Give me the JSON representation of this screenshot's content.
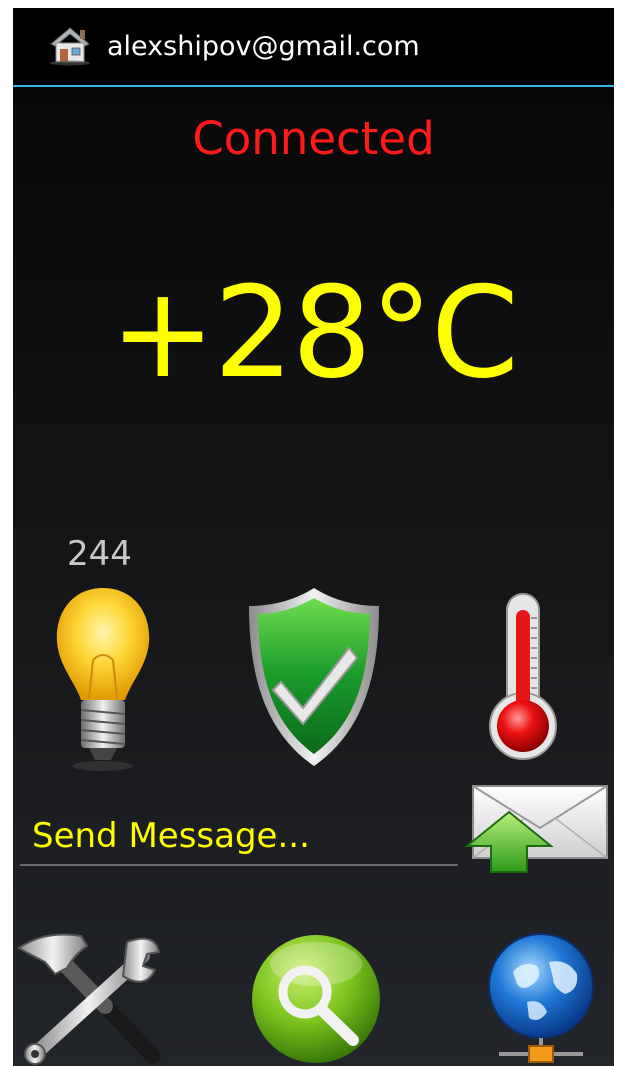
{
  "header": {
    "account": "alexshipov@gmail.com",
    "icon": "home-icon"
  },
  "status": {
    "text": "Connected",
    "color": "#ff1a1a"
  },
  "temperature": {
    "text": "+28°C",
    "color": "#ffff00"
  },
  "sensors": {
    "light_value": "244",
    "icons": [
      "light-bulb-icon",
      "security-shield-check-icon",
      "thermometer-icon"
    ]
  },
  "message": {
    "placeholder": "Send Message...",
    "send_icon": "send-mail-icon"
  },
  "toolbar": {
    "icons": [
      "tools-settings-icon",
      "search-icon",
      "network-globe-icon"
    ]
  },
  "colors": {
    "accent": "#33b5e5",
    "text_yellow": "#ffff00"
  }
}
